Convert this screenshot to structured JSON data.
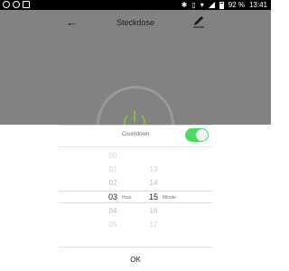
{
  "status_bar": {
    "battery": "92 %",
    "time": "13:41"
  },
  "header": {
    "title": "Steckdose"
  },
  "timer_sheet": {
    "countdown_label": "Countdown",
    "toggle_on": true,
    "hours": [
      "00",
      "01",
      "02",
      "03",
      "04",
      "05",
      "06"
    ],
    "minutes": [
      "13",
      "14",
      "15",
      "16",
      "17",
      "18"
    ],
    "selected_hour": "03",
    "selected_minute": "15",
    "hour_unit": "Hour",
    "minute_unit": "Minute",
    "ok_label": "OK"
  },
  "colors": {
    "accent": "#4cd964",
    "dim_overlay": "#828282",
    "power_green": "#7fbf3f"
  }
}
